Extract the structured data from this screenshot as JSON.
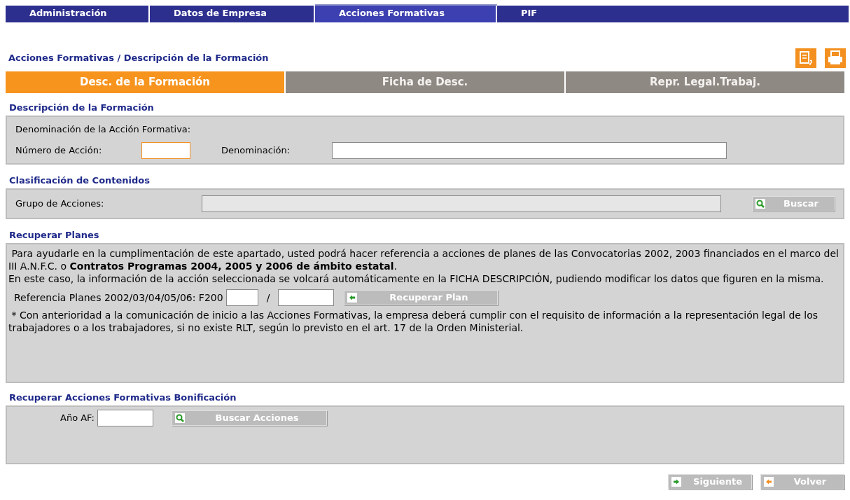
{
  "nav": [
    {
      "label": "Administración",
      "selected": false
    },
    {
      "label": "Datos de Empresa",
      "selected": false
    },
    {
      "label": "Acciones Formativas",
      "selected": true
    },
    {
      "label": "PIF",
      "selected": false
    }
  ],
  "breadcrumb": "Acciones Formativas / Descripción de la Formación",
  "tabs": [
    {
      "label": "Desc. de la Formación",
      "selected": true
    },
    {
      "label": "Ficha de Desc.",
      "selected": false
    },
    {
      "label": "Repr. Legal.Trabaj.",
      "selected": false
    }
  ],
  "descripcion": {
    "title": "Descripción de la Formación",
    "subtitle": "Denominación de la Acción Formativa:",
    "numero": {
      "label": "Número de Acción:",
      "focused": true
    },
    "denominacion": {
      "label": "Denominación:",
      "focused": false
    }
  },
  "clasificacion": {
    "title": "Clasificación de Contenidos",
    "label": "Grupo de Acciones:",
    "disabled": true,
    "button": "Buscar"
  },
  "recuperar_planes": {
    "title": "Recuperar Planes",
    "paragraphs": [
      " Para ayudarle en la cumplimentación de este apartado, usted podrá hacer referencia a acciones de planes de las Convocatorias 2002, 2003 financiados en el marco del III A.N.F.C. o **Contratos Programas 2004, 2005 y 2006 de ámbito estatal**.",
      "En este caso, la información de la acción seleccionada se volcará automáticamente en la FICHA DESCRIPCIÓN, pudiendo modificar los datos que figuren en la misma."
    ],
    "ref_label": "Referencia Planes 2002/03/04/05/06: F200",
    "separator": "/",
    "button": "Recuperar Plan",
    "note": "* Con anterioridad a la comunicación de inicio a las Acciones Formativas, la empresa deberá cumplir con el requisito de información a la representación legal de los trabajadores o a los trabajadores, si no existe RLT, según lo previsto en el art. 17 de la Orden Ministerial."
  },
  "bonificacion": {
    "title": "Recuperar Acciones Formativas Bonificación",
    "label": "Año AF:",
    "button": "Buscar Acciones"
  },
  "footer_buttons": [
    {
      "label": "Siguiente",
      "kind": "next"
    },
    {
      "label": "Volver",
      "kind": "back"
    }
  ]
}
